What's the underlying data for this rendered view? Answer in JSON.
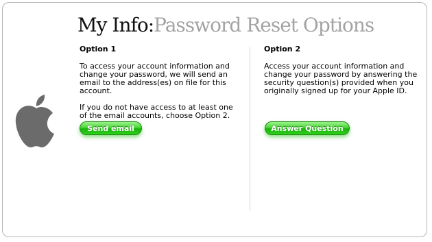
{
  "header": {
    "title_main": "My Info:",
    "title_sub": "Password Reset Options"
  },
  "option1": {
    "heading": "Option 1",
    "paragraph1": "To access your account information and change your password, we will send an email to the address(es) on file for this account.",
    "paragraph2": "If you do not have access to at least one of the email accounts, choose Option 2.",
    "button_label": "Send email"
  },
  "option2": {
    "heading": "Option 2",
    "paragraph1": "Access your account information and change your password by answering the security question(s) provided when you originally signed up for your Apple ID.",
    "button_label": "Answer Question"
  },
  "icons": {
    "logo": "apple-logo-icon"
  },
  "colors": {
    "button_green": "#2fc81e",
    "title_gray": "#a3a3a3",
    "logo_gray": "#6b6b6b"
  }
}
